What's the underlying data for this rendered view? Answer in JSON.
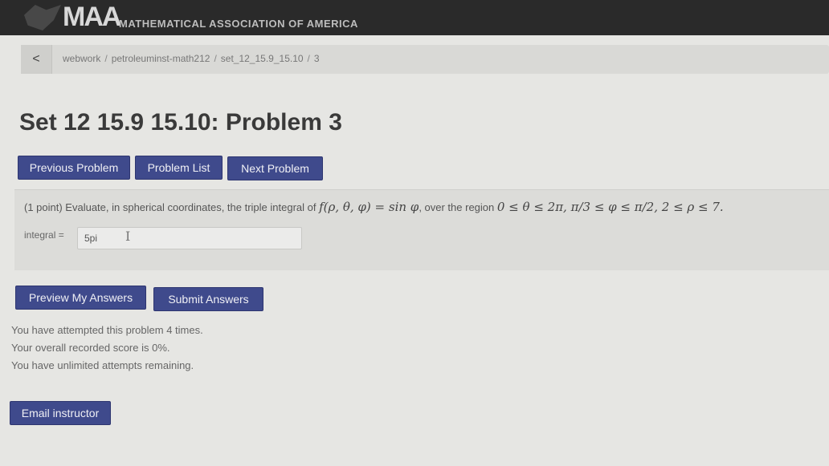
{
  "header": {
    "logo_text": "MAA",
    "logo_subtitle": "MATHEMATICAL ASSOCIATION OF AMERICA"
  },
  "breadcrumb": {
    "back_label": "<",
    "items": [
      "webwork",
      "petroleuminst-math212",
      "set_12_15.9_15.10",
      "3"
    ]
  },
  "page_title": "Set 12 15.9 15.10: Problem 3",
  "nav": {
    "previous": "Previous Problem",
    "list": "Problem List",
    "next": "Next Problem"
  },
  "problem": {
    "intro": "(1 point) Evaluate, in spherical coordinates, the triple integral of ",
    "function": "f(ρ, θ, φ) = sin φ",
    "middle": ", over the region ",
    "region": "0 ≤ θ ≤ 2π, π/3 ≤ φ ≤ π/2, 2 ≤ ρ ≤ 7."
  },
  "answer": {
    "label": "integral =",
    "value": "5pi"
  },
  "actions": {
    "preview": "Preview My Answers",
    "submit": "Submit Answers"
  },
  "status": {
    "attempts": "You have attempted this problem 4 times.",
    "score": "Your overall recorded score is 0%.",
    "remaining": "You have unlimited attempts remaining."
  },
  "email_label": "Email instructor",
  "colors": {
    "button": "#3f4a8c",
    "topbar": "#2a2a2a"
  }
}
